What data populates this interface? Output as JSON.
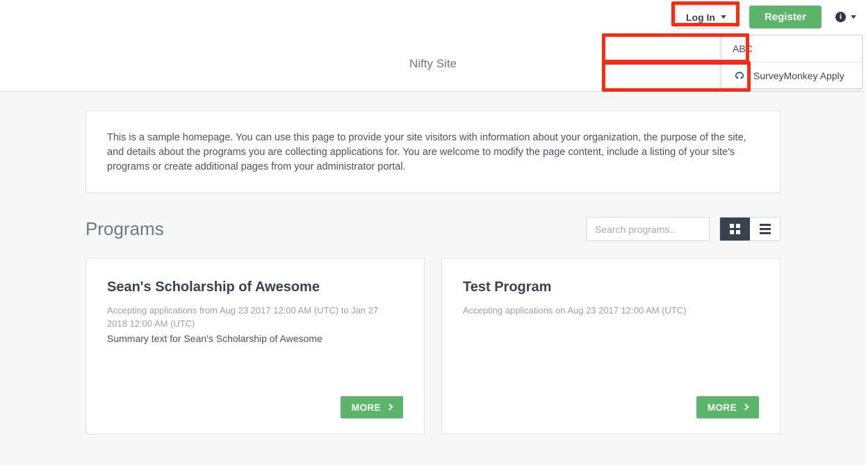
{
  "header": {
    "site_title": "Nifty Site",
    "login_label": "Log In",
    "register_label": "Register",
    "info_icon_label": "i",
    "login_dropdown": {
      "items": [
        {
          "label": "ABC",
          "icon": ""
        },
        {
          "label": "SurveyMonkey Apply",
          "icon": "surveymonkey-logo"
        }
      ]
    }
  },
  "intro": {
    "text": "This is a sample homepage. You can use this page to provide your site visitors with information about your organization, the purpose of the site, and details about the programs you are collecting applications for. You are welcome to modify the page content, include a listing of your site's programs or create additional pages from your administrator portal."
  },
  "programs": {
    "heading": "Programs",
    "search_placeholder": "Search programs..",
    "search_value": "",
    "active_view": "grid",
    "cards": [
      {
        "name": "Sean's Scholarship of Awesome",
        "dates": "Accepting applications from Aug 23 2017 12:00 AM (UTC) to Jan 27 2018 12:00 AM (UTC)",
        "summary": "Summary text for Sean's Scholarship of Awesome",
        "more_label": "MORE"
      },
      {
        "name": "Test Program",
        "dates": "Accepting applications on Aug 23 2017 12:00 AM (UTC)",
        "summary": "",
        "more_label": "MORE"
      }
    ]
  },
  "colors": {
    "accent_green": "#5cb56b",
    "dark_slate": "#39424e",
    "annotation_red": "#fa2b12",
    "page_background": "#f7f8f8"
  }
}
